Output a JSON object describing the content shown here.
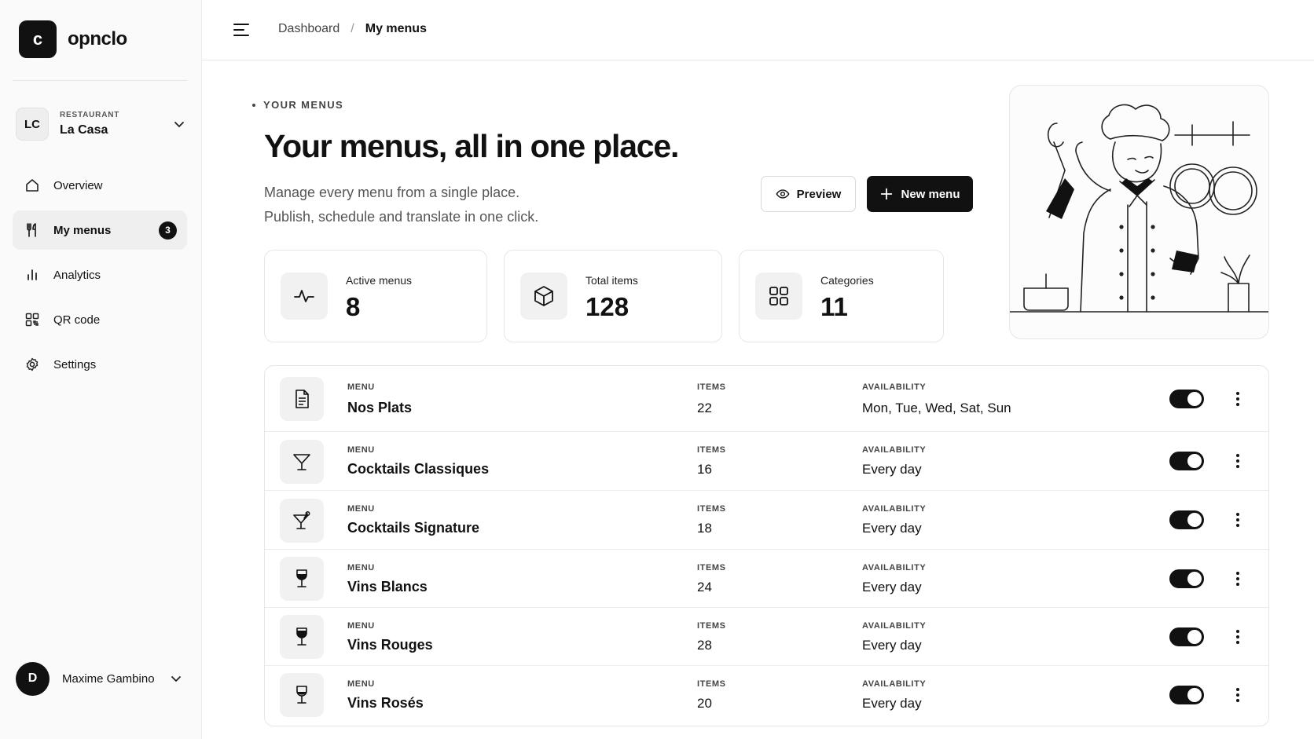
{
  "brand": {
    "logo_letter": "c",
    "name": "opnclo"
  },
  "restaurant": {
    "initials": "LC",
    "label": "RESTAURANT",
    "name": "La Casa"
  },
  "nav": [
    {
      "label": "Overview",
      "icon": "home-icon"
    },
    {
      "label": "My menus",
      "icon": "utensils-icon",
      "badge": "3",
      "active": true
    },
    {
      "label": "Analytics",
      "icon": "bar-chart-icon"
    },
    {
      "label": "QR code",
      "icon": "qr-code-icon"
    },
    {
      "label": "Settings",
      "icon": "gear-icon"
    }
  ],
  "user": {
    "initial": "D",
    "name": "Maxime Gambino"
  },
  "breadcrumb": {
    "parent": "Dashboard",
    "separator": "/",
    "current": "My menus"
  },
  "hero": {
    "eyebrow": "YOUR MENUS",
    "title": "Your menus, all in one place.",
    "subtitle_line1": "Manage every menu from a single place.",
    "subtitle_line2": "Publish, schedule and translate in one click."
  },
  "actions": {
    "preview_label": "Preview",
    "new_menu_label": "New menu"
  },
  "stats": [
    {
      "label": "Active menus",
      "value": "8",
      "icon": "activity-pulse-icon"
    },
    {
      "label": "Total items",
      "value": "128",
      "icon": "box-icon"
    },
    {
      "label": "Categories",
      "value": "11",
      "icon": "grid-icon"
    }
  ],
  "table": {
    "col_menu": "MENU",
    "col_items": "ITEMS",
    "col_availability": "AVAILABILITY",
    "rows": [
      {
        "name": "Nos Plats",
        "items": "22",
        "availability": "Mon, Tue, Wed, Sat, Sun",
        "icon": "document-icon",
        "enabled": true
      },
      {
        "name": "Cocktails Classiques",
        "items": "16",
        "availability": "Every day",
        "icon": "martini-glass-icon",
        "enabled": true
      },
      {
        "name": "Cocktails Signature",
        "items": "18",
        "availability": "Every day",
        "icon": "cocktail-icon",
        "enabled": true
      },
      {
        "name": "Vins Blancs",
        "items": "24",
        "availability": "Every day",
        "icon": "wine-glass-icon",
        "enabled": true
      },
      {
        "name": "Vins Rouges",
        "items": "28",
        "availability": "Every day",
        "icon": "wine-glass-filled-icon",
        "enabled": true
      },
      {
        "name": "Vins Rosés",
        "items": "20",
        "availability": "Every day",
        "icon": "wine-glass-icon",
        "enabled": true
      }
    ]
  },
  "colors": {
    "accent": "#111111",
    "background": "#ffffff",
    "sidebar": "#fafafa",
    "border": "#e6e6e6"
  }
}
